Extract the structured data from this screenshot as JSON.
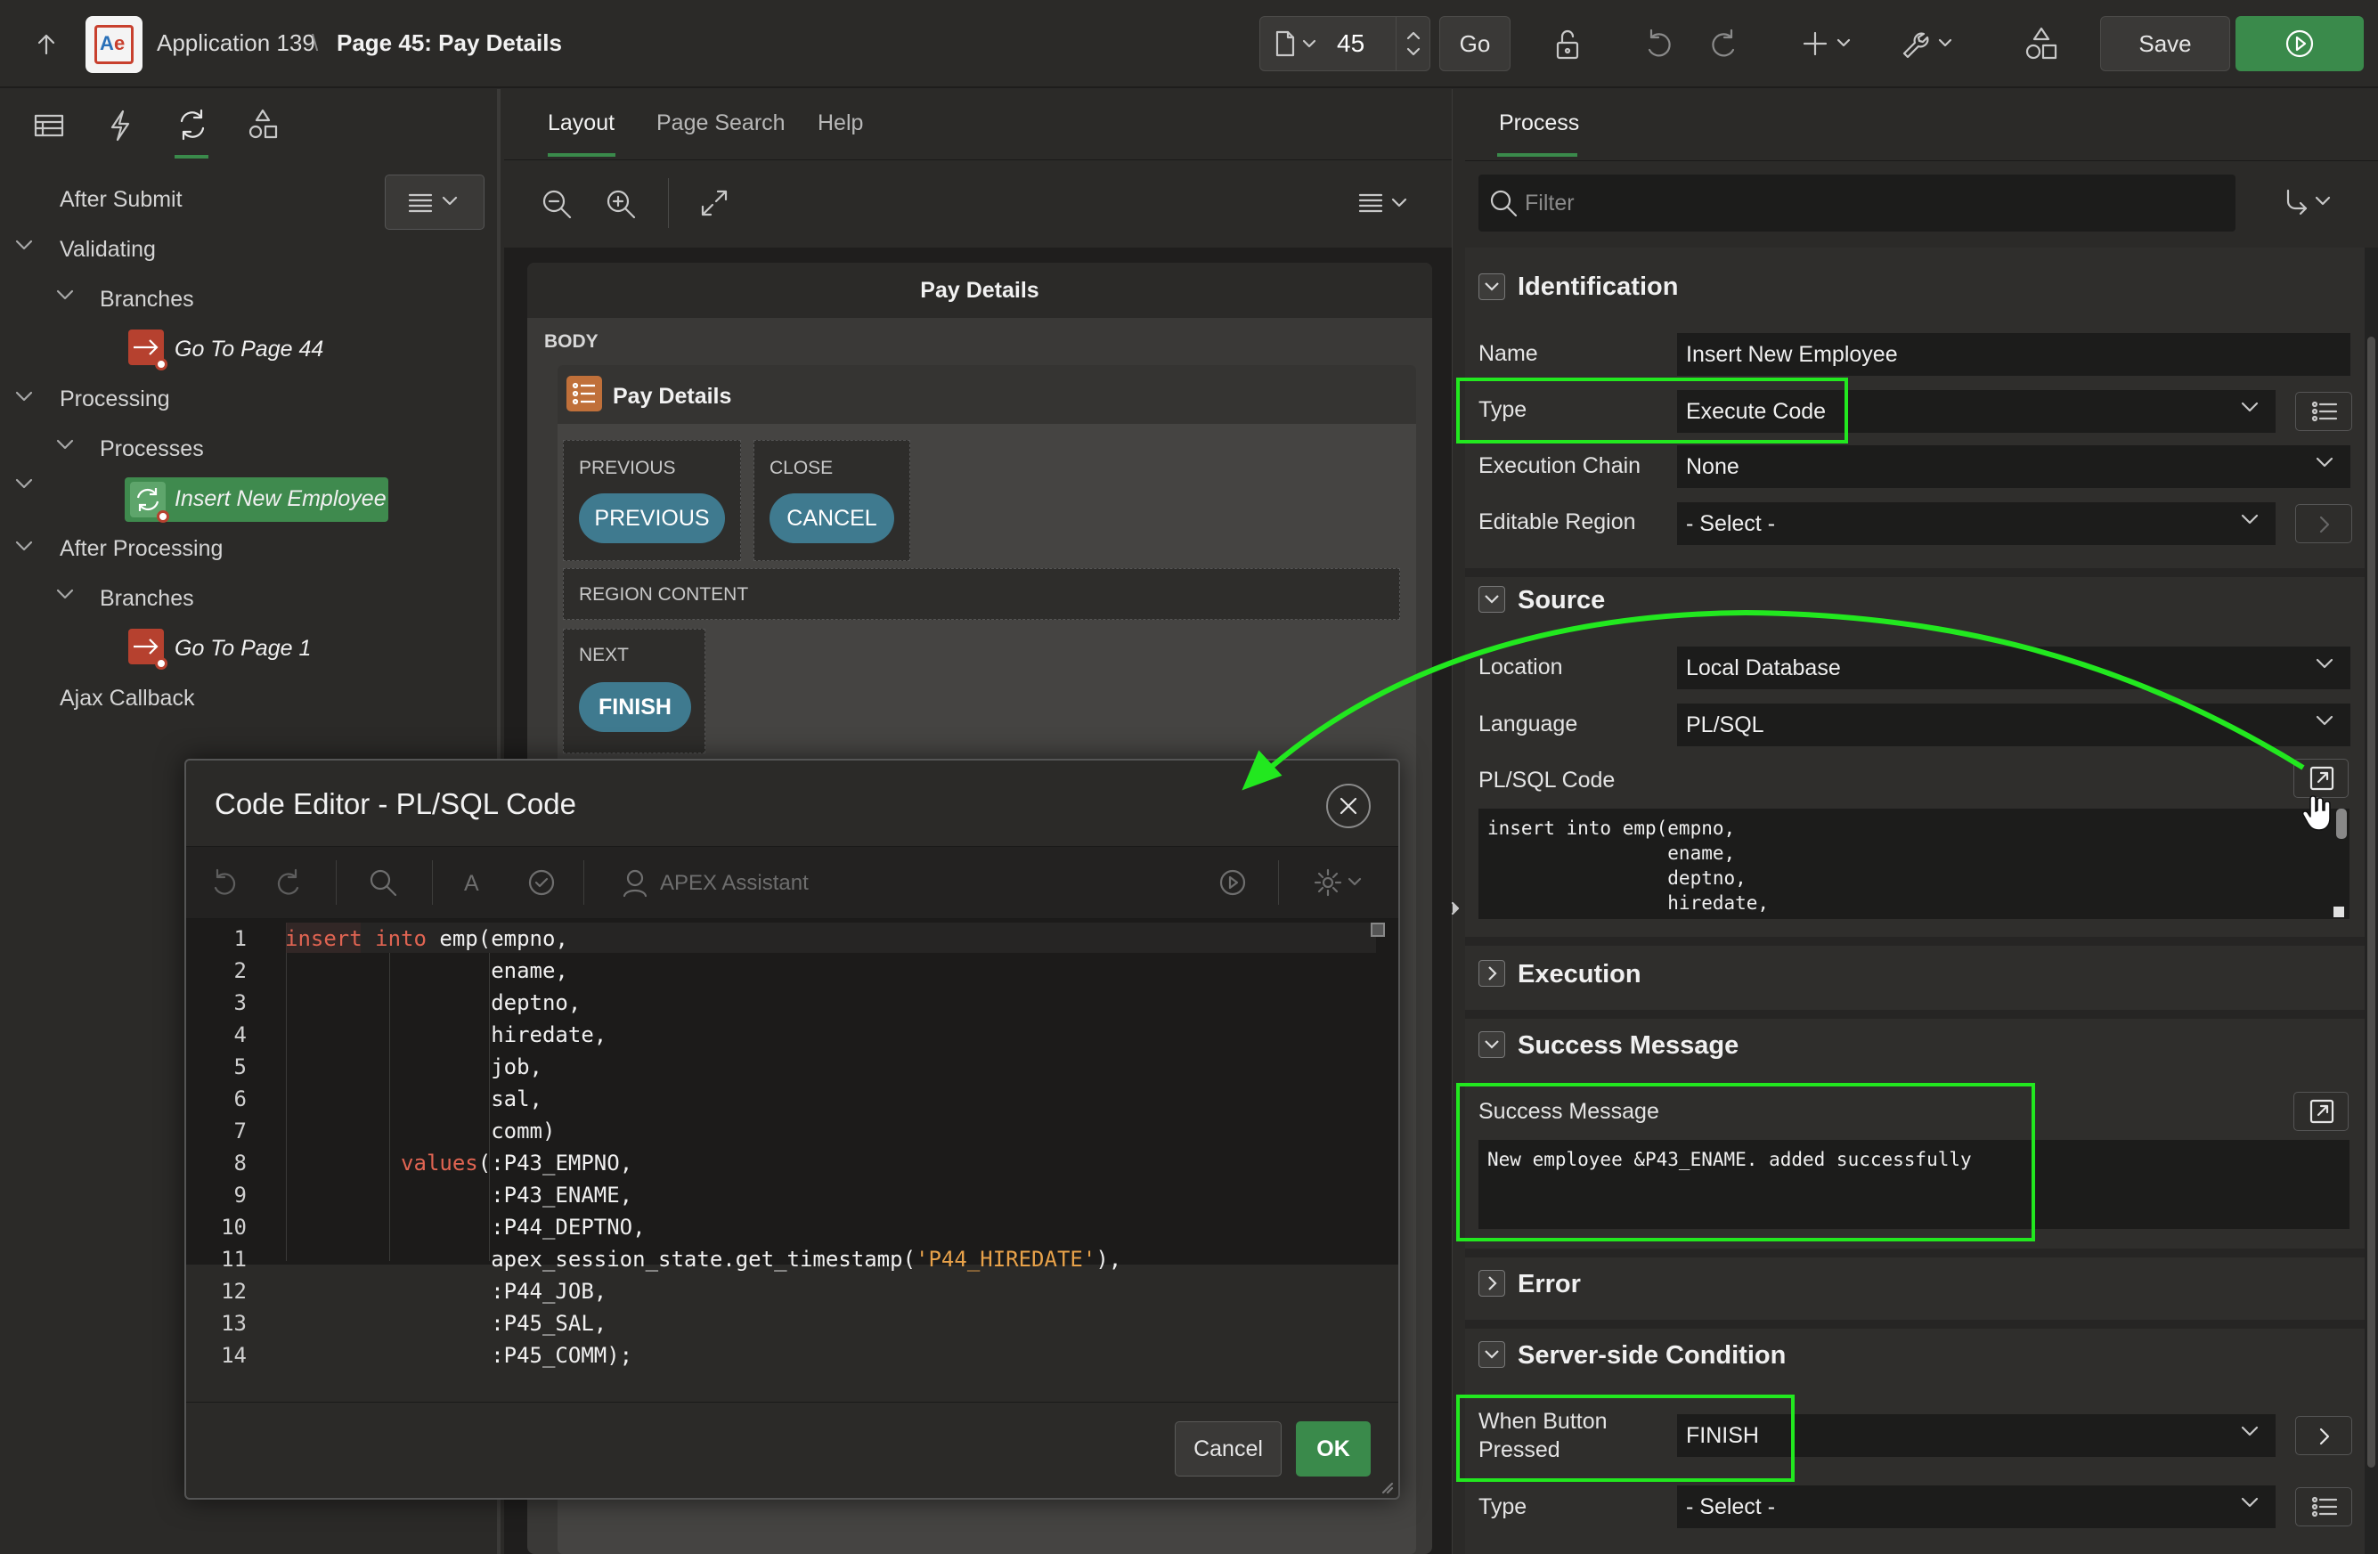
{
  "header": {
    "app_name": "Application 139",
    "page_name": "Page 45: Pay Details",
    "page_number": "45",
    "go_label": "Go",
    "save_label": "Save"
  },
  "left_tree": {
    "after_submit": "After Submit",
    "validating": "Validating",
    "branches1": "Branches",
    "go_to_page_44": "Go To Page 44",
    "processing": "Processing",
    "processes": "Processes",
    "insert_new_employee": "Insert New Employee",
    "after_processing": "After Processing",
    "branches2": "Branches",
    "go_to_page_1": "Go To Page 1",
    "ajax_callback": "Ajax Callback"
  },
  "middle": {
    "tabs": [
      "Layout",
      "Page Search",
      "Help"
    ],
    "page_title": "Pay Details",
    "body_label": "BODY",
    "region_title": "Pay Details",
    "previous_slot": "PREVIOUS",
    "previous_btn": "PREVIOUS",
    "close_slot": "CLOSE",
    "cancel_btn": "CANCEL",
    "region_content": "REGION CONTENT",
    "next_slot": "NEXT",
    "finish_btn": "FINISH"
  },
  "right": {
    "tab": "Process",
    "filter_placeholder": "Filter",
    "identification": "Identification",
    "name_label": "Name",
    "name_value": "Insert New Employee",
    "type_label": "Type",
    "type_value": "Execute Code",
    "exec_chain_label": "Execution Chain",
    "exec_chain_value": "None",
    "editable_region_label": "Editable Region",
    "editable_region_value": "- Select -",
    "source": "Source",
    "location_label": "Location",
    "location_value": "Local Database",
    "language_label": "Language",
    "language_value": "PL/SQL",
    "plsql_label": "PL/SQL Code",
    "plsql_preview": "insert into emp(empno,\n                ename,\n                deptno,\n                hiredate,",
    "execution": "Execution",
    "success_section": "Success Message",
    "success_label": "Success Message",
    "success_value": "New employee &P43_ENAME. added successfully",
    "error": "Error",
    "server_cond": "Server-side Condition",
    "when_button_label_1": "When Button",
    "when_button_label_2": "Pressed",
    "when_button_value": "FINISH",
    "cond_type_label": "Type",
    "cond_type_value": "- Select -"
  },
  "modal": {
    "title": "Code Editor - PL/SQL Code",
    "assistant": "APEX Assistant",
    "font_icon": "A",
    "cancel": "Cancel",
    "ok": "OK",
    "line_numbers": [
      "1",
      "2",
      "3",
      "4",
      "5",
      "6",
      "7",
      "8",
      "9",
      "10",
      "11",
      "12",
      "13",
      "14"
    ]
  },
  "colors": {
    "highlight": "#22e81f",
    "accent_green": "#3a8a4b",
    "region_button": "#3f7a8f",
    "branch_icon": "#b6412f",
    "process_node": "#3f8a4e"
  }
}
